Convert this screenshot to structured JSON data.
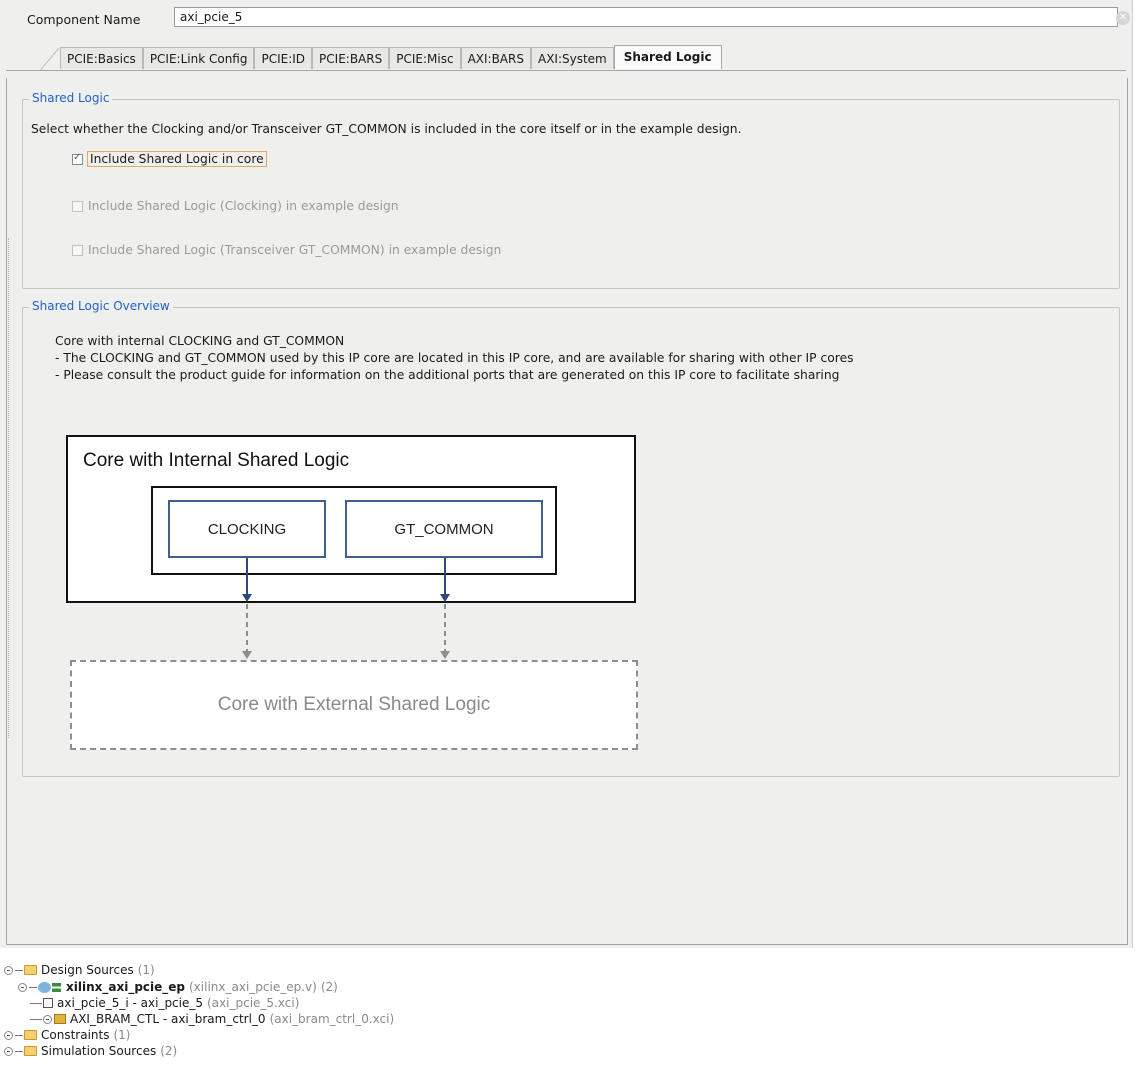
{
  "component": {
    "label": "Component Name",
    "value": "axi_pcie_5"
  },
  "tabs": [
    {
      "label": "PCIE:Basics",
      "active": false
    },
    {
      "label": "PCIE:Link Config",
      "active": false
    },
    {
      "label": "PCIE:ID",
      "active": false
    },
    {
      "label": "PCIE:BARS",
      "active": false
    },
    {
      "label": "PCIE:Misc",
      "active": false
    },
    {
      "label": "AXI:BARS",
      "active": false
    },
    {
      "label": "AXI:System",
      "active": false
    },
    {
      "label": "Shared Logic",
      "active": true
    }
  ],
  "shared_logic": {
    "title": "Shared Logic",
    "description": "Select whether the Clocking and/or Transceiver GT_COMMON is included in the core itself or in the example design.",
    "options": [
      {
        "label": "Include Shared Logic in core",
        "checked": true,
        "enabled": true
      },
      {
        "label": "Include Shared Logic (Clocking) in example design",
        "checked": false,
        "enabled": false
      },
      {
        "label": "Include Shared Logic (Transceiver GT_COMMON) in example design",
        "checked": false,
        "enabled": false
      }
    ]
  },
  "overview": {
    "title": "Shared Logic Overview",
    "lines": [
      "Core with internal CLOCKING and GT_COMMON",
      "- The CLOCKING and GT_COMMON used by this IP core are located in this IP core, and are available for sharing with other IP cores",
      "- Please consult the product guide for information on the additional ports that are generated on this IP core to facilitate sharing"
    ],
    "diagram": {
      "outer_title": "Core with Internal Shared Logic",
      "block1": "CLOCKING",
      "block2": "GT_COMMON",
      "external": "Core with External Shared Logic"
    }
  },
  "sources_tree": {
    "design_sources": {
      "label": "Design Sources",
      "count": "(1)"
    },
    "top": {
      "name": "xilinx_axi_pcie_ep",
      "file": "(xilinx_axi_pcie_ep.v)",
      "count": "(2)"
    },
    "child1": {
      "name": "axi_pcie_5_i - axi_pcie_5",
      "file": "(axi_pcie_5.xci)"
    },
    "child2": {
      "name": "AXI_BRAM_CTL - axi_bram_ctrl_0",
      "file": "(axi_bram_ctrl_0.xci)"
    },
    "constraints": {
      "label": "Constraints",
      "count": "(1)"
    },
    "simulation": {
      "label": "Simulation Sources",
      "count": "(2)"
    }
  },
  "colors": {
    "group_title": "#2461c9",
    "block_border": "#3f5f8c",
    "arrow": "#2b4a7a",
    "focus_outline": "#e1a95a"
  },
  "icons": {
    "clear": "clear-input-icon",
    "checkbox": "checkbox-icon",
    "folder": "folder-icon",
    "verilog": "verilog-file-icon",
    "xci": "xci-file-icon",
    "bram": "bram-ip-icon"
  }
}
